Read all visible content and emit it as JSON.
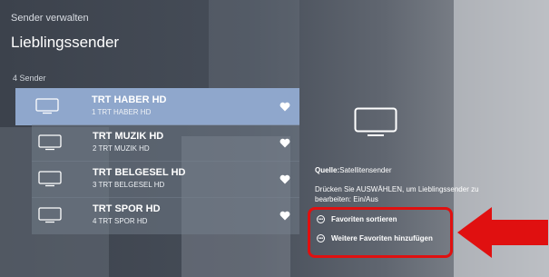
{
  "header": {
    "subtitle": "Sender verwalten",
    "title": "Lieblingssender",
    "count": "4 Sender"
  },
  "channels": [
    {
      "name": "TRT HABER HD",
      "number": "1 TRT HABER HD",
      "selected": true,
      "favorite_icon": "heart-icon"
    },
    {
      "name": "TRT MUZIK HD",
      "number": "2 TRT MUZIK HD",
      "selected": false,
      "favorite_icon": "heart-icon"
    },
    {
      "name": "TRT BELGESEL HD",
      "number": "3 TRT BELGESEL HD",
      "selected": false,
      "favorite_icon": "heart-icon"
    },
    {
      "name": "TRT SPOR HD",
      "number": "4 TRT SPOR HD",
      "selected": false,
      "favorite_icon": "heart-icon"
    }
  ],
  "details": {
    "source_label": "Quelle:",
    "source_value": "Satellitensender",
    "help_text": "Drücken Sie AUSWÄHLEN, um Lieblingssender zu bearbeiten: Ein/Aus"
  },
  "options": [
    {
      "label": "Favoriten sortieren",
      "icon": "options-icon"
    },
    {
      "label": "Weitere Favoriten hinzufügen",
      "icon": "options-icon"
    }
  ],
  "colors": {
    "selected_row": "#8fa7cc",
    "annotation_red": "#e01010"
  }
}
